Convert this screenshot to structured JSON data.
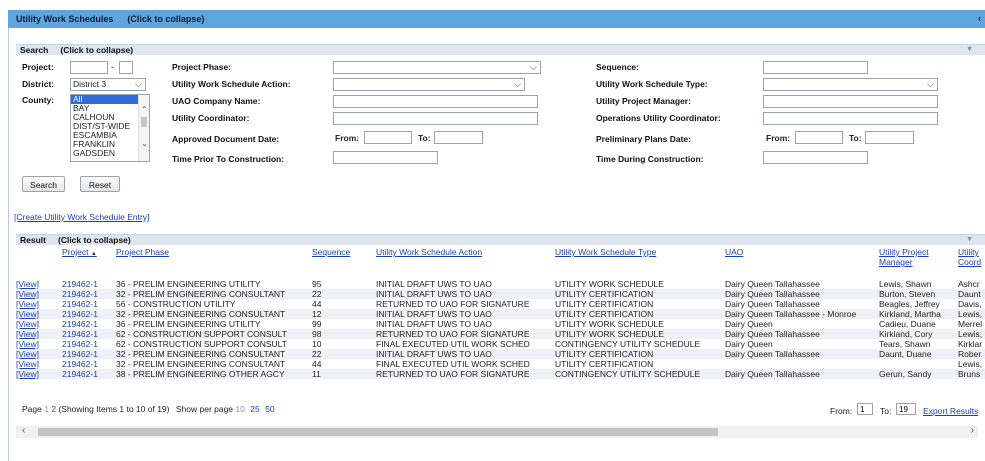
{
  "header": {
    "title": "Utility Work Schedules",
    "collapse": "(Click to collapse)"
  },
  "search": {
    "title": "Search",
    "collapse": "(Click to collapse)",
    "project_label": "Project:",
    "project_sep": "-",
    "district_label": "District:",
    "district_value": "District 3",
    "county_label": "County:",
    "county_options": [
      "All",
      "BAY",
      "CALHOUN",
      "DIST/ST-WIDE",
      "ESCAMBIA",
      "FRANKLIN",
      "GADSDEN"
    ],
    "project_phase_label": "Project Phase:",
    "uws_action_label": "Utility Work Schedule Action:",
    "uao_company_label": "UAO Company Name:",
    "utility_coordinator_label": "Utility Coordinator:",
    "approved_doc_date_label": "Approved Document Date:",
    "from_label": "From:",
    "to_label": "To:",
    "time_prior_label": "Time Prior To Construction:",
    "sequence_label": "Sequence:",
    "uws_type_label": "Utility Work Schedule Type:",
    "utility_pm_label": "Utility Project Manager:",
    "ops_coordinator_label": "Operations Utility Coordinator:",
    "prelim_plans_date_label": "Preliminary Plans Date:",
    "time_during_label": "Time During Construction:",
    "search_button": "Search",
    "reset_button": "Reset"
  },
  "create_link": "[Create Utility Work Schedule Entry]",
  "result": {
    "title": "Result",
    "collapse": "(Click to collapse)",
    "columns": {
      "project": "Project",
      "sort_indicator": "▲",
      "phase": "Project Phase",
      "sequence": "Sequence",
      "action": "Utility Work Schedule Action",
      "type": "Utility Work Schedule Type",
      "uao": "UAO",
      "manager_1": "Utility Project",
      "manager_2": "Manager",
      "coord_1": "Utility",
      "coord_2": "Coord"
    },
    "view_label": "[View]",
    "rows": [
      {
        "project": "219462-1",
        "phase": "36 - PRELIM ENGINEERING UTILITY",
        "sequence": "95",
        "action": "INITIAL DRAFT UWS TO UAO",
        "type": "UTILITY WORK SCHEDULE",
        "uao": "Dairy Queen Tallahassee",
        "manager": "Lewis, Shawn",
        "coord": "Ashcr"
      },
      {
        "project": "219462-1",
        "phase": "32 - PRELIM ENGINEERING CONSULTANT",
        "sequence": "22",
        "action": "INITIAL DRAFT UWS TO UAO",
        "type": "UTILITY CERTIFICATION",
        "uao": "Dairy Queen Tallahassee",
        "manager": "Burton, Steven",
        "coord": "Daunt"
      },
      {
        "project": "219462-1",
        "phase": "56 - CONSTRUCTION UTILITY",
        "sequence": "44",
        "action": "RETURNED TO UAO FOR SIGNATURE",
        "type": "UTILITY CERTIFICATION",
        "uao": "Dairy Queen Tallahassee",
        "manager": "Beagles, Jeffrey",
        "coord": "Davis,"
      },
      {
        "project": "219462-1",
        "phase": "32 - PRELIM ENGINEERING CONSULTANT",
        "sequence": "12",
        "action": "INITIAL DRAFT UWS TO UAO",
        "type": "UTILITY CERTIFICATION",
        "uao": "Dairy Queen Tallahassee - Monroe",
        "manager": "Kirkland, Martha",
        "coord": "Lewis,"
      },
      {
        "project": "219462-1",
        "phase": "36 - PRELIM ENGINEERING UTILITY",
        "sequence": "99",
        "action": "INITIAL DRAFT UWS TO UAO",
        "type": "UTILITY WORK SCHEDULE",
        "uao": "Dairy Queen",
        "manager": "Cadieu, Duane",
        "coord": "Merrel"
      },
      {
        "project": "219462-1",
        "phase": "62 - CONSTRUCTION SUPPORT CONSULT",
        "sequence": "98",
        "action": "RETURNED TO UAO FOR SIGNATURE",
        "type": "UTILITY WORK SCHEDULE",
        "uao": "Dairy Queen Tallahassee",
        "manager": "Kirkland, Cory",
        "coord": "Lewis,"
      },
      {
        "project": "219462-1",
        "phase": "62 - CONSTRUCTION SUPPORT CONSULT",
        "sequence": "10",
        "action": "FINAL EXECUTED UTIL WORK SCHED",
        "type": "CONTINGENCY UTILITY SCHEDULE",
        "uao": "Dairy Queen",
        "manager": "Tears, Shawn",
        "coord": "Kirklar"
      },
      {
        "project": "219462-1",
        "phase": "32 - PRELIM ENGINEERING CONSULTANT",
        "sequence": "22",
        "action": "INITIAL DRAFT UWS TO UAO",
        "type": "UTILITY CERTIFICATION",
        "uao": "Dairy Queen Tallahassee",
        "manager": "Daunt, Duane",
        "coord": "Rober"
      },
      {
        "project": "219462-1",
        "phase": "32 - PRELIM ENGINEERING CONSULTANT",
        "sequence": "44",
        "action": "FINAL EXECUTED UTIL WORK SCHED",
        "type": "UTILITY CERTIFICATION",
        "uao": "",
        "manager": "",
        "coord": "Lewis,"
      },
      {
        "project": "219462-1",
        "phase": "38 - PRELIM ENGINEERING OTHER AGCY",
        "sequence": "11",
        "action": "RETURNED TO UAO FOR SIGNATURE",
        "type": "CONTINGENCY UTILITY SCHEDULE",
        "uao": "Dairy Queen Tallahassee",
        "manager": "Gerun, Sandy",
        "coord": "Bruns"
      }
    ]
  },
  "pager": {
    "page_label": "Page",
    "page_1": "1",
    "page_2": "2",
    "showing": "(Showing Items 1 to 10 of 19)",
    "show_per_page": "Show per page",
    "pp_10": "10",
    "pp_25": "25",
    "pp_50": "50",
    "from_label": "From:",
    "from_value": "1",
    "to_label": "To:",
    "to_value": "19",
    "export": "Export Results"
  }
}
